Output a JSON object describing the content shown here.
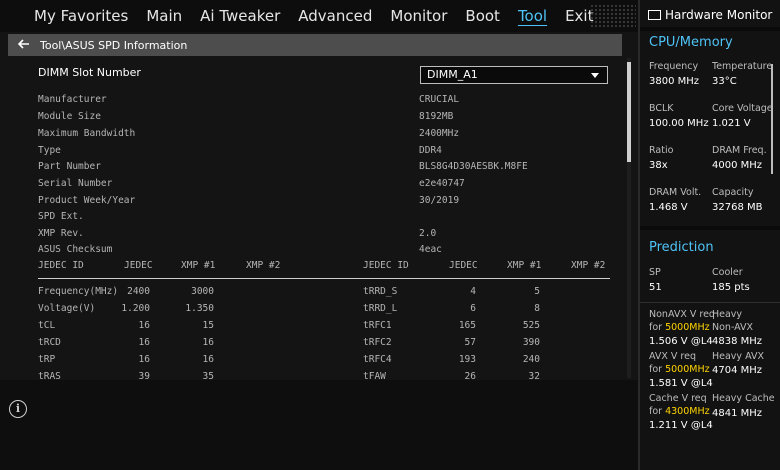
{
  "nav": {
    "tabs": [
      "My Favorites",
      "Main",
      "Ai Tweaker",
      "Advanced",
      "Monitor",
      "Boot",
      "Tool",
      "Exit"
    ],
    "active": "Tool"
  },
  "breadcrumb": "Tool\\ASUS SPD Information",
  "dimm": {
    "label": "DIMM Slot Number",
    "selected": "DIMM_A1"
  },
  "info": [
    {
      "label": "Manufacturer",
      "value": "CRUCIAL"
    },
    {
      "label": "Module Size",
      "value": "8192MB"
    },
    {
      "label": "Maximum Bandwidth",
      "value": "2400MHz"
    },
    {
      "label": "Type",
      "value": "DDR4"
    },
    {
      "label": "Part Number",
      "value": "BLS8G4D30AESBK.M8FE"
    },
    {
      "label": "Serial Number",
      "value": "e2e40747"
    },
    {
      "label": "Product Week/Year",
      "value": "30/2019"
    },
    {
      "label": "SPD Ext.",
      "value": ""
    },
    {
      "label": "XMP Rev.",
      "value": "2.0"
    },
    {
      "label": "ASUS Checksum",
      "value": "4eac"
    }
  ],
  "table": {
    "headers": [
      "JEDEC ID",
      "JEDEC",
      "XMP #1",
      "XMP #2",
      "JEDEC ID",
      "JEDEC",
      "XMP #1",
      "XMP #2"
    ],
    "rows": [
      [
        "Frequency(MHz)",
        "2400",
        "3000",
        "",
        "tRRD_S",
        "4",
        "5",
        ""
      ],
      [
        "Voltage(V)",
        "1.200",
        "1.350",
        "",
        "tRRD_L",
        "6",
        "8",
        ""
      ],
      [
        "tCL",
        "16",
        "15",
        "",
        "tRFC1",
        "165",
        "525",
        ""
      ],
      [
        "tRCD",
        "16",
        "16",
        "",
        "tRFC2",
        "57",
        "390",
        ""
      ],
      [
        "tRP",
        "16",
        "16",
        "",
        "tRFC4",
        "193",
        "240",
        ""
      ],
      [
        "tRAS",
        "39",
        "35",
        "",
        "tFAW",
        "26",
        "32",
        ""
      ]
    ]
  },
  "hardware_monitor": {
    "title": "Hardware Monitor",
    "cpu_memory": {
      "title": "CPU/Memory",
      "items": [
        {
          "label": "Frequency",
          "value": "3800 MHz"
        },
        {
          "label": "Temperature",
          "value": "33°C"
        },
        {
          "label": "BCLK",
          "value": "100.00 MHz"
        },
        {
          "label": "Core Voltage",
          "value": "1.021 V"
        },
        {
          "label": "Ratio",
          "value": "38x"
        },
        {
          "label": "DRAM Freq.",
          "value": "4000 MHz"
        },
        {
          "label": "DRAM Volt.",
          "value": "1.468 V"
        },
        {
          "label": "Capacity",
          "value": "32768 MB"
        }
      ]
    },
    "prediction": {
      "title": "Prediction",
      "sp_label": "SP",
      "sp_value": "51",
      "cooler_label": "Cooler",
      "cooler_value": "185 pts",
      "nonavx_label1": "NonAVX V req",
      "nonavx_label2": "for",
      "nonavx_freq": "5000MHz",
      "nonavx_value": "1.506 V @L4",
      "heavy_nonavx_label1": "Heavy",
      "heavy_nonavx_label2": "Non-AVX",
      "heavy_nonavx_value": "4838 MHz",
      "avx_label1": "AVX V req",
      "avx_label2": "for",
      "avx_freq": "5000MHz",
      "avx_value": "1.581 V @L4",
      "heavy_avx_label": "Heavy AVX",
      "heavy_avx_value": "4704 MHz",
      "cache_label1": "Cache V req",
      "cache_label2": "for",
      "cache_freq": "4300MHz",
      "cache_value": "1.211 V @L4",
      "heavy_cache_label": "Heavy Cache",
      "heavy_cache_value": "4841 MHz"
    }
  },
  "colors": {
    "accent": "#4fc3f7",
    "highlight": "#ffd400"
  },
  "icons": {
    "back": "arrow-left-icon",
    "info": "info-icon",
    "monitor": "monitor-icon",
    "dropdown": "chevron-down-icon"
  }
}
